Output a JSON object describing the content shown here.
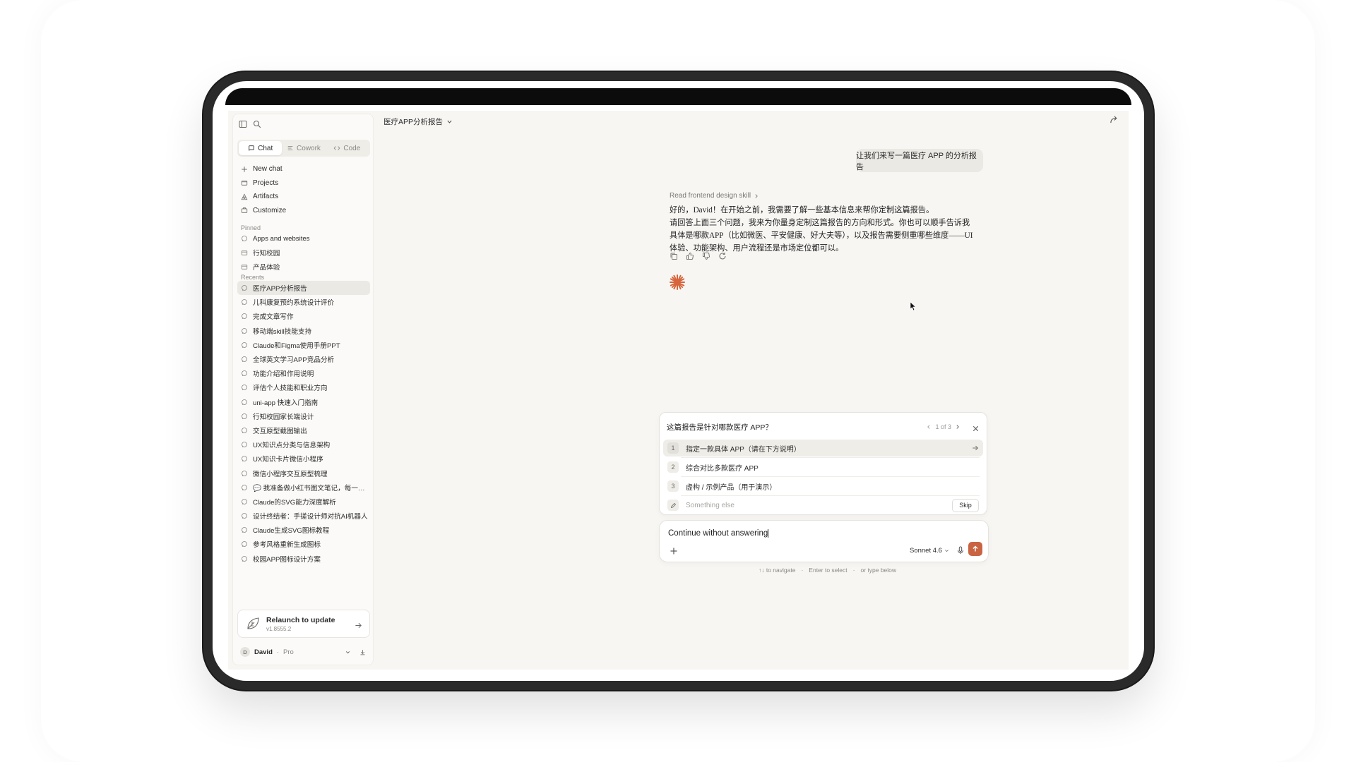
{
  "conversation_title": "医疗APP分析报告",
  "sidebar": {
    "modes": [
      {
        "label": "Chat",
        "icon": "chat-icon",
        "active": true
      },
      {
        "label": "Cowork",
        "icon": "cowork-icon",
        "active": false
      },
      {
        "label": "Code",
        "icon": "code-icon",
        "active": false
      }
    ],
    "nav": [
      {
        "label": "New chat",
        "icon": "plus-icon"
      },
      {
        "label": "Projects",
        "icon": "folder-icon"
      },
      {
        "label": "Artifacts",
        "icon": "artifacts-icon"
      },
      {
        "label": "Customize",
        "icon": "customize-icon"
      }
    ],
    "pinned_label": "Pinned",
    "pinned": [
      {
        "label": "Apps and websites",
        "icon": "chat-bubble-icon"
      },
      {
        "label": "行知校园",
        "icon": "project-icon"
      },
      {
        "label": "产品体验",
        "icon": "project-icon"
      }
    ],
    "recents_label": "Recents",
    "recents": [
      "医疗APP分析报告",
      "儿科康复预约系统设计评价",
      "完成文章写作",
      "移动端skill技能支持",
      "Claude和Figma使用手册PPT",
      "全球英文学习APP竞品分析",
      "功能介绍和作用说明",
      "评估个人技能和职业方向",
      "uni-app 快速入门指南",
      "行知校园家长端设计",
      "交互原型截图输出",
      "UX知识点分类与信息架构",
      "UX知识卡片微信小程序",
      "微信小程序交互原型梳理",
      "💬 我准备做小红书图文笔记，每一个笔",
      "Claude的SVG能力深度解析",
      "设计终结者：手搓设计师对抗AI机器人",
      "Claude生成SVG图标教程",
      "参考风格重新生成图标",
      "校园APP图标设计方案"
    ],
    "active_recent_index": 0,
    "update": {
      "title": "Relaunch to update",
      "version": "v1.8555.2"
    },
    "user": {
      "initial": "D",
      "name": "David",
      "separator": "·",
      "plan": "Pro"
    }
  },
  "chat": {
    "user_message": "让我们来写一篇医疗 APP 的分析报告",
    "skill_line": "Read frontend design skill",
    "assistant_paragraph_1": "好的，David！在开始之前，我需要了解一些基本信息来帮你定制这篇报告。",
    "assistant_paragraph_2": "请回答上面三个问题，我来为你量身定制这篇报告的方向和形式。你也可以顺手告诉我具体是哪款APP（比如微医、平安健康、好大夫等），以及报告需要侧重哪些维度——UI 体验、功能架构、用户流程还是市场定位都可以。"
  },
  "question": {
    "title": "这篇报告是针对哪款医疗 APP？",
    "pager": "1 of 3",
    "options": [
      {
        "num": "1",
        "label": "指定一款具体 APP（请在下方说明）"
      },
      {
        "num": "2",
        "label": "综合对比多款医疗 APP"
      },
      {
        "num": "3",
        "label": "虚构 / 示例产品（用于演示）"
      }
    ],
    "other_placeholder": "Something else",
    "skip_label": "Skip"
  },
  "composer": {
    "value": "Continue without answering",
    "model": "Sonnet 4.6"
  },
  "hints": {
    "navigate": "↑↓ to navigate",
    "dot": "·",
    "select": "Enter to select",
    "type": "or type below"
  },
  "colors": {
    "accent": "#c96442",
    "spark": "#d6653b",
    "background": "#f7f6f3"
  }
}
